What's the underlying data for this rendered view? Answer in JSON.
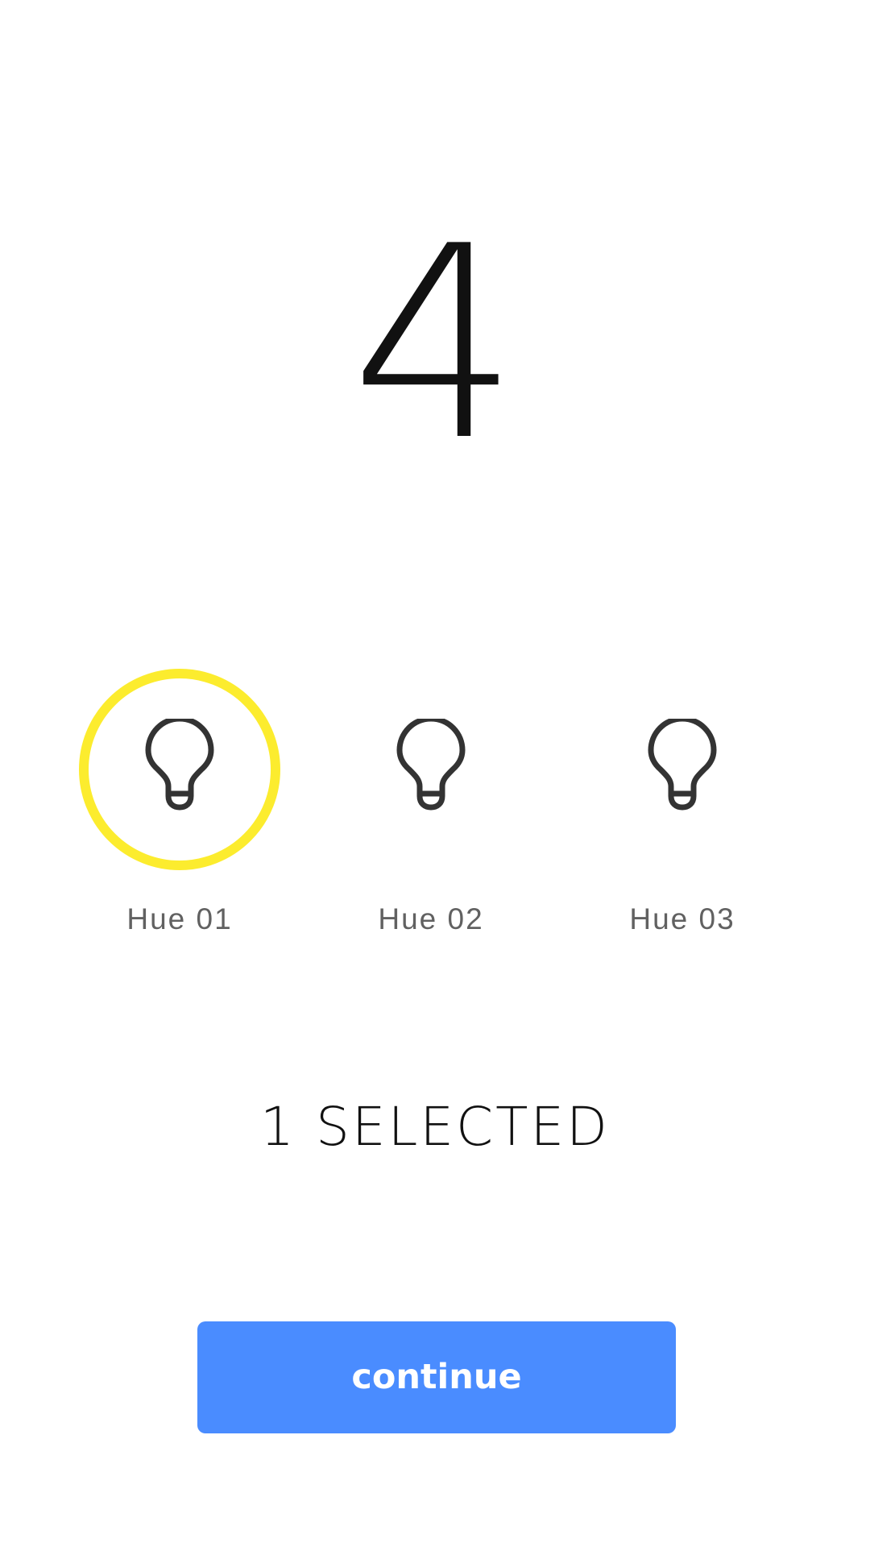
{
  "header": {
    "big_number": "4"
  },
  "bulbs": [
    {
      "label": "Hue 01",
      "selected": true,
      "icon": "lightbulb-icon"
    },
    {
      "label": "Hue 02",
      "selected": false,
      "icon": "lightbulb-icon"
    },
    {
      "label": "Hue 03",
      "selected": false,
      "icon": "lightbulb-icon"
    }
  ],
  "status": {
    "selected_text": "1 SELECTED"
  },
  "actions": {
    "continue_label": "continue"
  },
  "colors": {
    "selection_ring": "#fcec2e",
    "button_background": "#4a8cff",
    "icon_stroke": "#333333",
    "label_text": "#616161"
  }
}
